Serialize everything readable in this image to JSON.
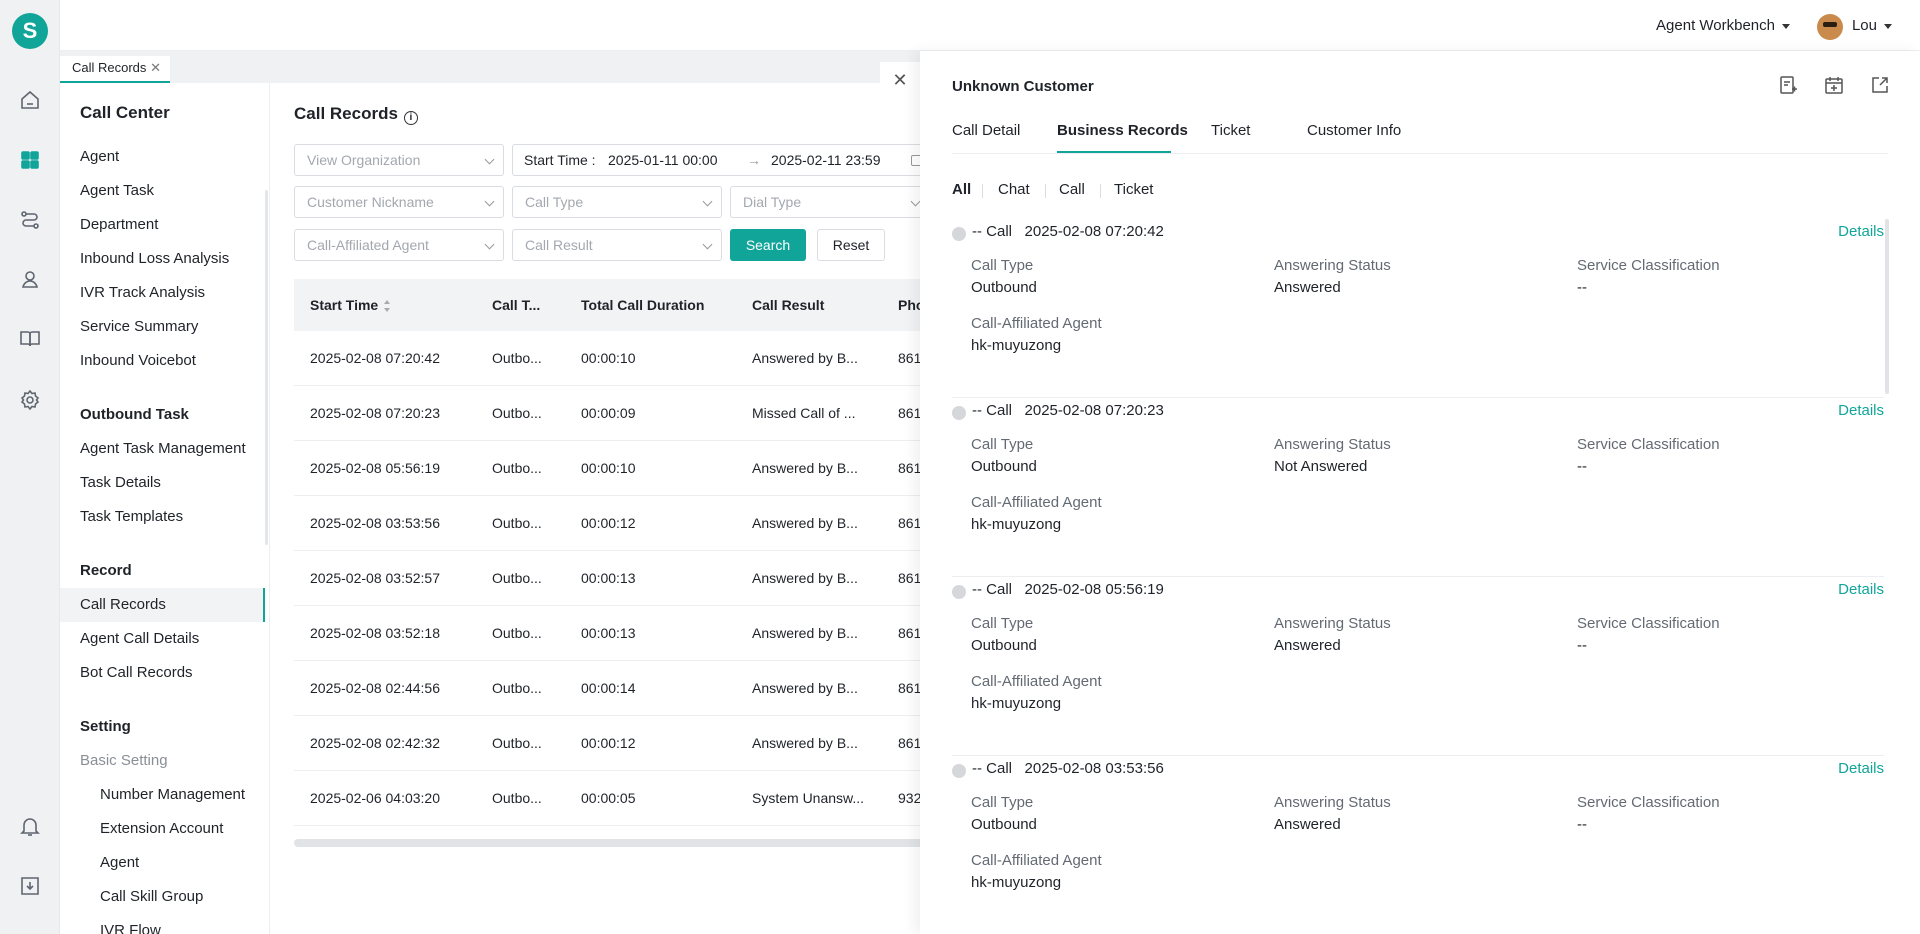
{
  "app": {
    "logo_letter": "S",
    "accent": "#11a59a"
  },
  "topbar": {
    "workbench_label": "Agent Workbench",
    "user_name": "Lou"
  },
  "tabs": [
    {
      "label": "Call Records",
      "close": "✕"
    }
  ],
  "sidebar": {
    "title": "Call Center",
    "items": [
      "Agent",
      "Agent Task",
      "Department",
      "Inbound Loss Analysis",
      "IVR Track Analysis",
      "Service Summary",
      "Inbound Voicebot"
    ],
    "outbound_title": "Outbound Task",
    "outbound_items": [
      "Agent Task Management",
      "Task Details",
      "Task Templates"
    ],
    "record_title": "Record",
    "record_items": [
      "Call Records",
      "Agent Call Details",
      "Bot Call Records"
    ],
    "setting_title": "Setting",
    "basic_setting": "Basic Setting",
    "setting_items": [
      "Number Management",
      "Extension Account",
      "Agent",
      "Call Skill Group",
      "IVR Flow"
    ]
  },
  "main": {
    "title": "Call Records",
    "filters": {
      "organization": "View Organization",
      "start_time_label": "Start Time :",
      "start_date": "2025-01-11 00:00",
      "arrow": "→",
      "end_date": "2025-02-11 23:59",
      "customer_nickname": "Customer Nickname",
      "call_type": "Call Type",
      "dial_type": "Dial Type",
      "call_agent": "Call-Affiliated Agent",
      "call_result": "Call Result",
      "search": "Search",
      "reset": "Reset"
    },
    "columns": [
      "Start Time",
      "Call T...",
      "Total Call Duration",
      "Call Result",
      "Pho"
    ],
    "rows": [
      [
        "2025-02-08 07:20:42",
        "Outbo...",
        "00:00:10",
        "Answered by B...",
        "861"
      ],
      [
        "2025-02-08 07:20:23",
        "Outbo...",
        "00:00:09",
        "Missed Call of ...",
        "861"
      ],
      [
        "2025-02-08 05:56:19",
        "Outbo...",
        "00:00:10",
        "Answered by B...",
        "861"
      ],
      [
        "2025-02-08 03:53:56",
        "Outbo...",
        "00:00:12",
        "Answered by B...",
        "861"
      ],
      [
        "2025-02-08 03:52:57",
        "Outbo...",
        "00:00:13",
        "Answered by B...",
        "861"
      ],
      [
        "2025-02-08 03:52:18",
        "Outbo...",
        "00:00:13",
        "Answered by B...",
        "861"
      ],
      [
        "2025-02-08 02:44:56",
        "Outbo...",
        "00:00:14",
        "Answered by B...",
        "861"
      ],
      [
        "2025-02-08 02:42:32",
        "Outbo...",
        "00:00:12",
        "Answered by B...",
        "861"
      ],
      [
        "2025-02-06 04:03:20",
        "Outbo...",
        "00:00:05",
        "System Unansw...",
        "932"
      ]
    ]
  },
  "drawer": {
    "close": "✕",
    "title": "Unknown Customer",
    "tabs": [
      "Call Detail",
      "Business Records",
      "Ticket",
      "Customer Info"
    ],
    "active_tab": "Business Records",
    "filters": [
      "All",
      "Chat",
      "Call",
      "Ticket"
    ],
    "details_label": "Details",
    "labels": {
      "call_type": "Call Type",
      "answering_status": "Answering Status",
      "service_classification": "Service Classification",
      "agent": "Call-Affiliated Agent"
    },
    "records": [
      {
        "head": "-- Call",
        "time": "2025-02-08 07:20:42",
        "call_type": "Outbound",
        "answering_status": "Answered",
        "service_classification": "--",
        "agent": "hk-muyuzong"
      },
      {
        "head": "-- Call",
        "time": "2025-02-08 07:20:23",
        "call_type": "Outbound",
        "answering_status": "Not Answered",
        "service_classification": "--",
        "agent": "hk-muyuzong"
      },
      {
        "head": "-- Call",
        "time": "2025-02-08 05:56:19",
        "call_type": "Outbound",
        "answering_status": "Answered",
        "service_classification": "--",
        "agent": "hk-muyuzong"
      },
      {
        "head": "-- Call",
        "time": "2025-02-08 03:53:56",
        "call_type": "Outbound",
        "answering_status": "Answered",
        "service_classification": "--",
        "agent": "hk-muyuzong"
      }
    ]
  }
}
